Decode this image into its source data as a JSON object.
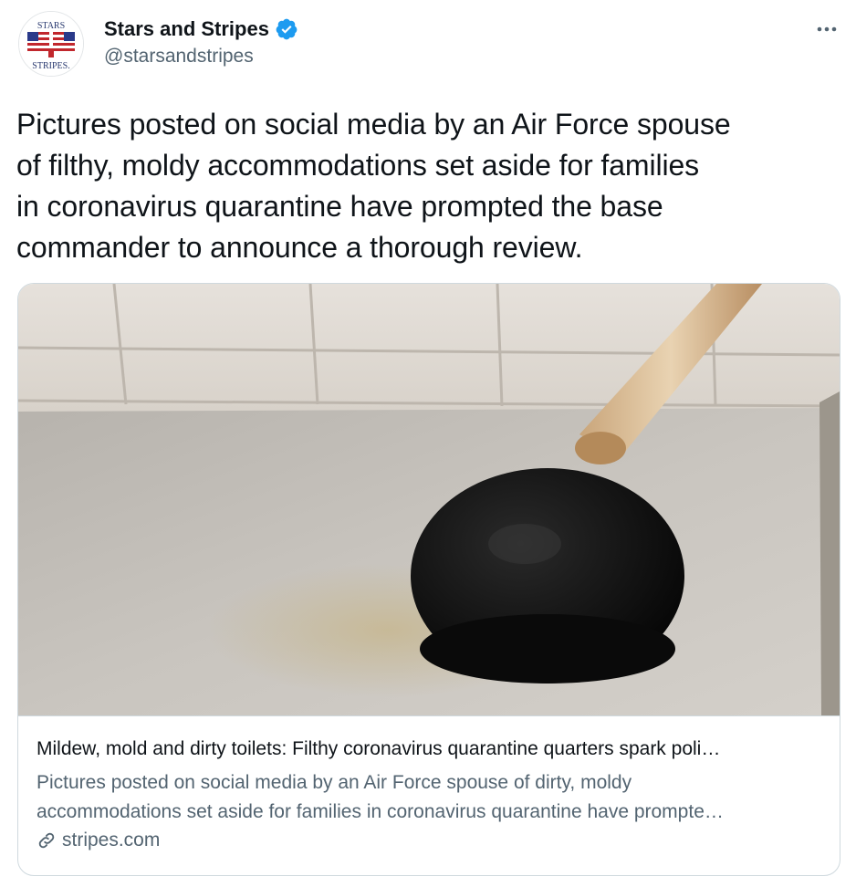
{
  "author": {
    "avatar_text_top": "STARS",
    "avatar_text_mid": "AND",
    "avatar_text_bottom": "STRIPES.",
    "display_name": "Stars and Stripes",
    "handle": "@starsandstripes",
    "verified": true,
    "verified_icon": "verified-badge-icon",
    "more_icon": "more-options-icon"
  },
  "tweet": {
    "text_lines": [
      "Pictures posted on social media by an Air Force spouse",
      "of filthy, moldy accommodations set aside for families",
      "in coronavirus quarantine have prompted the base",
      "commander to announce a thorough review."
    ]
  },
  "card": {
    "image_description_icon": "toilet-plunger-photo",
    "title": "Mildew, mold and dirty toilets: Filthy coronavirus quarantine quarters spark poli…",
    "description_lines": [
      "Pictures posted on social media by an Air Force spouse of dirty, moldy",
      "accommodations set aside for families in coronavirus quarantine have prompte…"
    ],
    "link_icon": "link-icon",
    "domain": "stripes.com"
  },
  "colors": {
    "text_primary": "#0f1419",
    "text_secondary": "#536471",
    "verified_blue": "#1d9bf0",
    "border": "#cfd9de"
  }
}
